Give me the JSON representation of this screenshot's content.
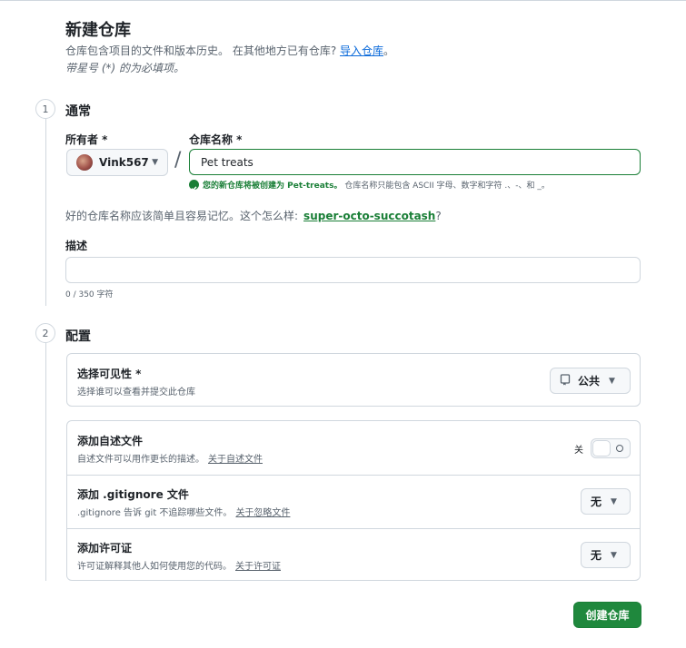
{
  "header": {
    "title": "新建仓库",
    "subtitle": "仓库包含项目的文件和版本历史。 在其他地方已有仓库?",
    "import_link": "导入仓库",
    "subtitle_end": "。",
    "required_note": "带星号 (*) 的为必填项。"
  },
  "section_general": {
    "step": "1",
    "heading": "通常",
    "owner_label": "所有者 *",
    "owner_value": "Vink567",
    "repo_label": "仓库名称 *",
    "repo_value": "Pet treats",
    "validation_bold": "您的新仓库将被创建为 Pet-treats。",
    "validation_rest": " 仓库名称只能包含 ASCII 字母、数字和字符 .、-、和 _。",
    "suggestion_text": "好的仓库名称应该简单且容易记忆。这个怎么样:",
    "suggestion_link": "super-octo-succotash",
    "suggestion_end": "?",
    "description_label": "描述",
    "description_value": "",
    "char_count": "0 / 350 字符"
  },
  "section_config": {
    "step": "2",
    "heading": "配置",
    "visibility": {
      "title": "选择可见性 *",
      "desc": "选择谁可以查看并提交此仓库",
      "selected": "公共"
    },
    "readme": {
      "title": "添加自述文件",
      "desc": "自述文件可以用作更长的描述。",
      "link": "关于自述文件",
      "toggle_state": "关"
    },
    "gitignore": {
      "title": "添加 .gitignore 文件",
      "desc": ".gitignore 告诉 git 不追踪哪些文件。",
      "link": "关于忽略文件",
      "selected": "无"
    },
    "license": {
      "title": "添加许可证",
      "desc": "许可证解释其他人如何使用您的代码。",
      "link": "关于许可证",
      "selected": "无"
    }
  },
  "actions": {
    "create_label": "创建仓库"
  },
  "colors": {
    "accent_green": "#1f883d",
    "link_blue": "#0969da",
    "border": "#d0d7de"
  }
}
